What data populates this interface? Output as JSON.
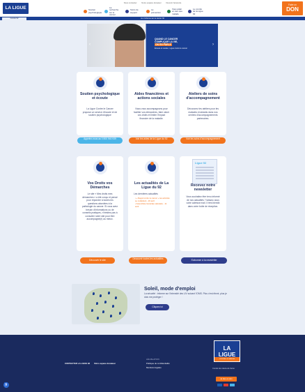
{
  "header": {
    "logo": "LA LIGUE",
    "top_links": [
      "Nous contacter",
      "Notre espace donateur",
      "Devenir bénévole"
    ],
    "nav": [
      {
        "label": "Soutien psychologique",
        "color": "#f2731c"
      },
      {
        "label": "La recherche sur le cancer",
        "color": "#4bb5e8"
      },
      {
        "label": "Soins de support",
        "color": "#2f3d8c"
      },
      {
        "label": "La prévention",
        "color": "#f2731c"
      },
      {
        "label": "Vous aider en tant que malade",
        "color": "#1a7a3f"
      },
      {
        "label": "Le comité de la Ligue 92",
        "color": "#2f3d8c"
      }
    ],
    "donate_small": "Faire un",
    "donate_big": "DON",
    "subbar_tag": "Comité 92",
    "subbar_msg": "Je m'informe sur le cancer 92"
  },
  "hero": {
    "line1": "QUAND LE CANCER",
    "line2": "COMPLIQUE LA VIE,",
    "highlight": "ON EN PARLE",
    "small": "Écoute et soutien, Ligue contre le cancer"
  },
  "cards_row1": [
    {
      "title": "Soutien psychologique et écoute",
      "text": "La Ligue Contre le Cancer propose un service d'écoute et de soutien psychologique",
      "button": "Appelez-nous au 0 800 940 939"
    },
    {
      "title": "Aides financières et actions sociales",
      "text": "Nous vous accompagnons pour faciliter vos démarches, faire valoir vos droits et limiter l'impact financier de la maladie.",
      "button": "Voir les aides de la Ligue du 92"
    },
    {
      "title": "Ateliers de soins d'accompagnement",
      "text": "Découvrez les ateliers pour les malades et aidants dans nos centres d'accompagnements partenaires.",
      "button": "Voir les soins d'accompagnement"
    }
  ],
  "cards_row2": [
    {
      "title": "Vos Droits vos Démarches",
      "text": "Le site « Mes droits mes démarches » a été conçu et pensé pour répondre à toutes les questions abordées à la pathologie du cancer. Si vous avez besoin d'informations ou de conseils pratiques, n'hésitez pas à consulter notre site pour être accompagné(e) au mieux.",
      "button": "Découvrir le site"
    },
    {
      "title": "Les actualités de La Ligue du 92",
      "text": "Les dernières actualités",
      "news": [
        "« Regal contre le cancer » les activités se multiplient - 26 avril",
        "Assemblée Générale statutaire - 11 avril"
      ],
      "button": "Découvrir toutes les actualités"
    },
    {
      "title": "Recevez notre newsletter",
      "text": "Vous souhaitez être tenu informé de nos actualités ? laissez-nous votre adresse mail. Il très bientôt dans votre boîte de réception.",
      "thumb_label": "Ligue 92",
      "button": "S'abonner à la newsletter"
    }
  ],
  "soleil": {
    "title": "Soleil, mode d'emploi",
    "text": "La sécurité : informe sur l'intensité des UV suivant l'OMS. Plus c'est élevé, plus je dois me protéger !",
    "button": "Cliquez ici"
  },
  "footer": {
    "contact": "CONTACTER LA LIGUE 92",
    "space": "Votre espace donateur",
    "legal_title": "LÉGISLATION",
    "legal_links": [
      "Politique de confidentialité",
      "Mentions légales"
    ],
    "logo": "LA LIGUE",
    "logo_strip": "CONTRE LE CANCER",
    "tagline": "Comité des Hauts-de-Seine",
    "donate": "Je fais un don"
  }
}
